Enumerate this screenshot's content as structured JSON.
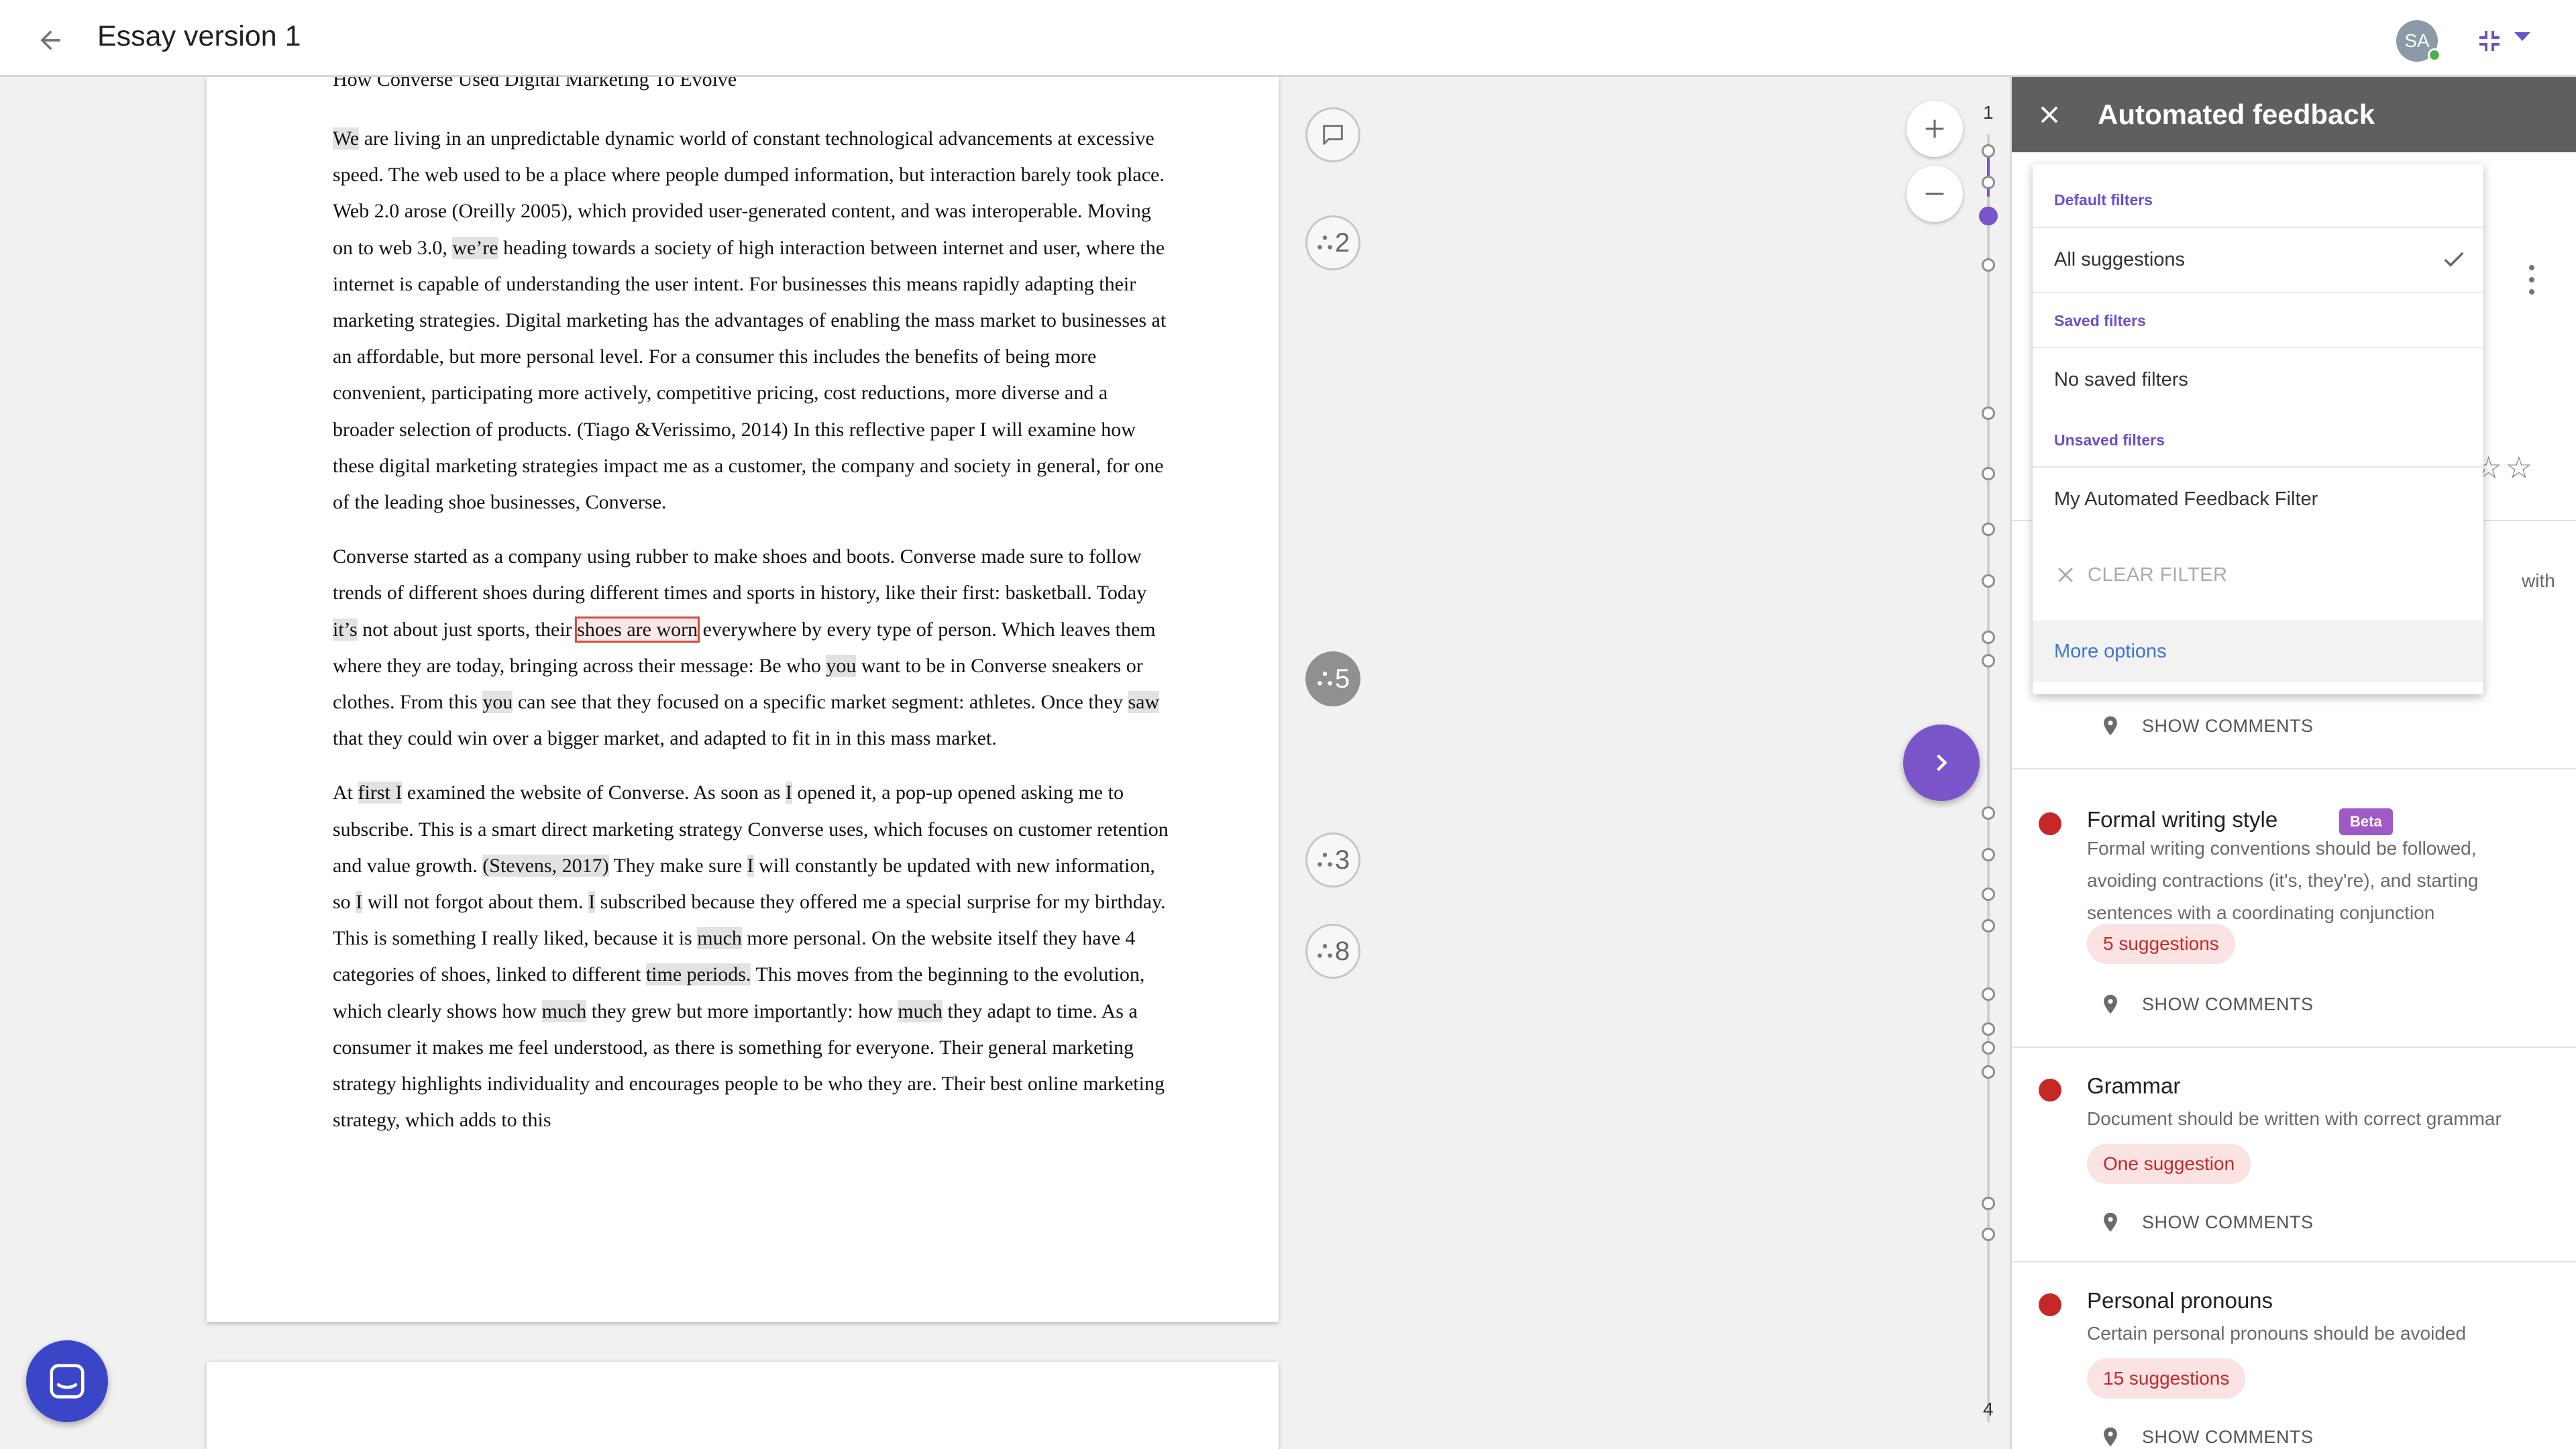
{
  "header": {
    "title": "Essay version 1",
    "avatar_initials": "SA",
    "presence_color": "#4caf50"
  },
  "document": {
    "cut_heading": "How Converse Used Digital Marketing To Evolve",
    "paragraphs": [
      [
        {
          "t": "We",
          "hl": true
        },
        {
          "t": " are living in an unpredictable dynamic world of constant technological advancements at excessive speed. The web used to be a place where people dumped information, but interaction barely took place. Web 2.0 arose (Oreilly 2005), which provided user-generated content, and was interoperable. Moving on to web 3.0, "
        },
        {
          "t": "we’re",
          "hl": true
        },
        {
          "t": " heading towards a society of high interaction between internet and user, where the internet is capable of understanding the user intent. For businesses this means rapidly adapting their marketing strategies. Digital marketing has the advantages of enabling the mass market to businesses at an affordable, but more personal level. For a consumer this includes the benefits of being more convenient, participating more actively, competitive pricing, cost reductions, more diverse and a broader selection of products. (Tiago &Verissimo, 2014)  In this reflective paper I will examine how these digital marketing strategies impact me as a customer, the company and society in general, for one of the leading shoe businesses, Converse."
        }
      ],
      [
        {
          "t": "Converse started as a company using rubber to make shoes and boots. Converse made sure to follow trends of different shoes during different times and sports in history, like their first: basketball. Today "
        },
        {
          "t": "it’s",
          "hl": true
        },
        {
          "t": " not about just sports, their "
        },
        {
          "t": "shoes are worn",
          "box": true
        },
        {
          "t": " everywhere by every type of person. Which leaves them where they are today, bringing across their message: Be who "
        },
        {
          "t": "you",
          "hl": true
        },
        {
          "t": " want to be in Converse sneakers or clothes. From this "
        },
        {
          "t": "you",
          "hl": true
        },
        {
          "t": " can see that they focused on a specific market segment: athletes. Once they "
        },
        {
          "t": "saw",
          "hl": true
        },
        {
          "t": " that they could win over a bigger market, and adapted to fit in in this mass market."
        }
      ],
      [
        {
          "t": "At "
        },
        {
          "t": "first I",
          "hl": true
        },
        {
          "t": " examined the website of Converse. As soon as "
        },
        {
          "t": "I",
          "hl": true
        },
        {
          "t": " opened it, a pop-up opened asking me to subscribe. This is a smart direct marketing strategy Converse uses, which focuses on customer retention and value growth. "
        },
        {
          "t": "(Stevens, 2017)",
          "hl": true
        },
        {
          "t": " They make sure "
        },
        {
          "t": "I",
          "hl": true
        },
        {
          "t": " will constantly be updated with new information, so "
        },
        {
          "t": "I",
          "hl": true
        },
        {
          "t": " will not forgot about them. "
        },
        {
          "t": "I",
          "hl": true
        },
        {
          "t": " subscribed because they offered me a special surprise for my birthday. This is something I really liked, because it is "
        },
        {
          "t": "much",
          "hl": true
        },
        {
          "t": " more personal. On the website itself they have 4 categories of shoes, linked to different "
        },
        {
          "t": "time periods.",
          "hl": true
        },
        {
          "t": " This moves from the beginning to the evolution, which clearly shows how "
        },
        {
          "t": "much",
          "hl": true
        },
        {
          "t": " they grew but more importantly: how "
        },
        {
          "t": "much",
          "hl": true
        },
        {
          "t": " they adapt to time. As a consumer it makes me feel understood, as there is something for everyone. Their general marketing strategy highlights individuality and encourages people to be who  they are. Their best online marketing strategy, which adds to this"
        }
      ]
    ]
  },
  "margin_badges": {
    "b1": "2",
    "b2": "5",
    "b3": "3",
    "b4": "8"
  },
  "timeline": {
    "page_start": "1",
    "page_end": "4",
    "accent_color": "#7a55c9"
  },
  "panel": {
    "title": "Automated feedback",
    "stars_partial": "☆☆",
    "partial_text": "with",
    "items": [
      {
        "title": "Formal writing style",
        "badge": "Beta",
        "description": "Formal writing conventions should be followed, avoiding contractions (it's, they're), and starting sentences with a coordinating conjunction",
        "suggestions": "5 suggestions",
        "show_comments": "SHOW COMMENTS"
      },
      {
        "title": "Grammar",
        "description": "Document should be written with correct grammar",
        "suggestions": "One suggestion",
        "show_comments": "SHOW COMMENTS"
      },
      {
        "title": "Personal pronouns",
        "description": "Certain personal pronouns should be avoided",
        "suggestions": "15 suggestions",
        "show_comments": "SHOW COMMENTS"
      }
    ],
    "show_comments_above": "SHOW COMMENTS",
    "status_color": "#c62828"
  },
  "filter_menu": {
    "default_label": "Default filters",
    "all_suggestions": "All suggestions",
    "saved_label": "Saved filters",
    "no_saved": "No saved filters",
    "unsaved_label": "Unsaved filters",
    "my_filter": "My Automated Feedback Filter",
    "clear_filter": "CLEAR FILTER",
    "more_options": "More options"
  }
}
